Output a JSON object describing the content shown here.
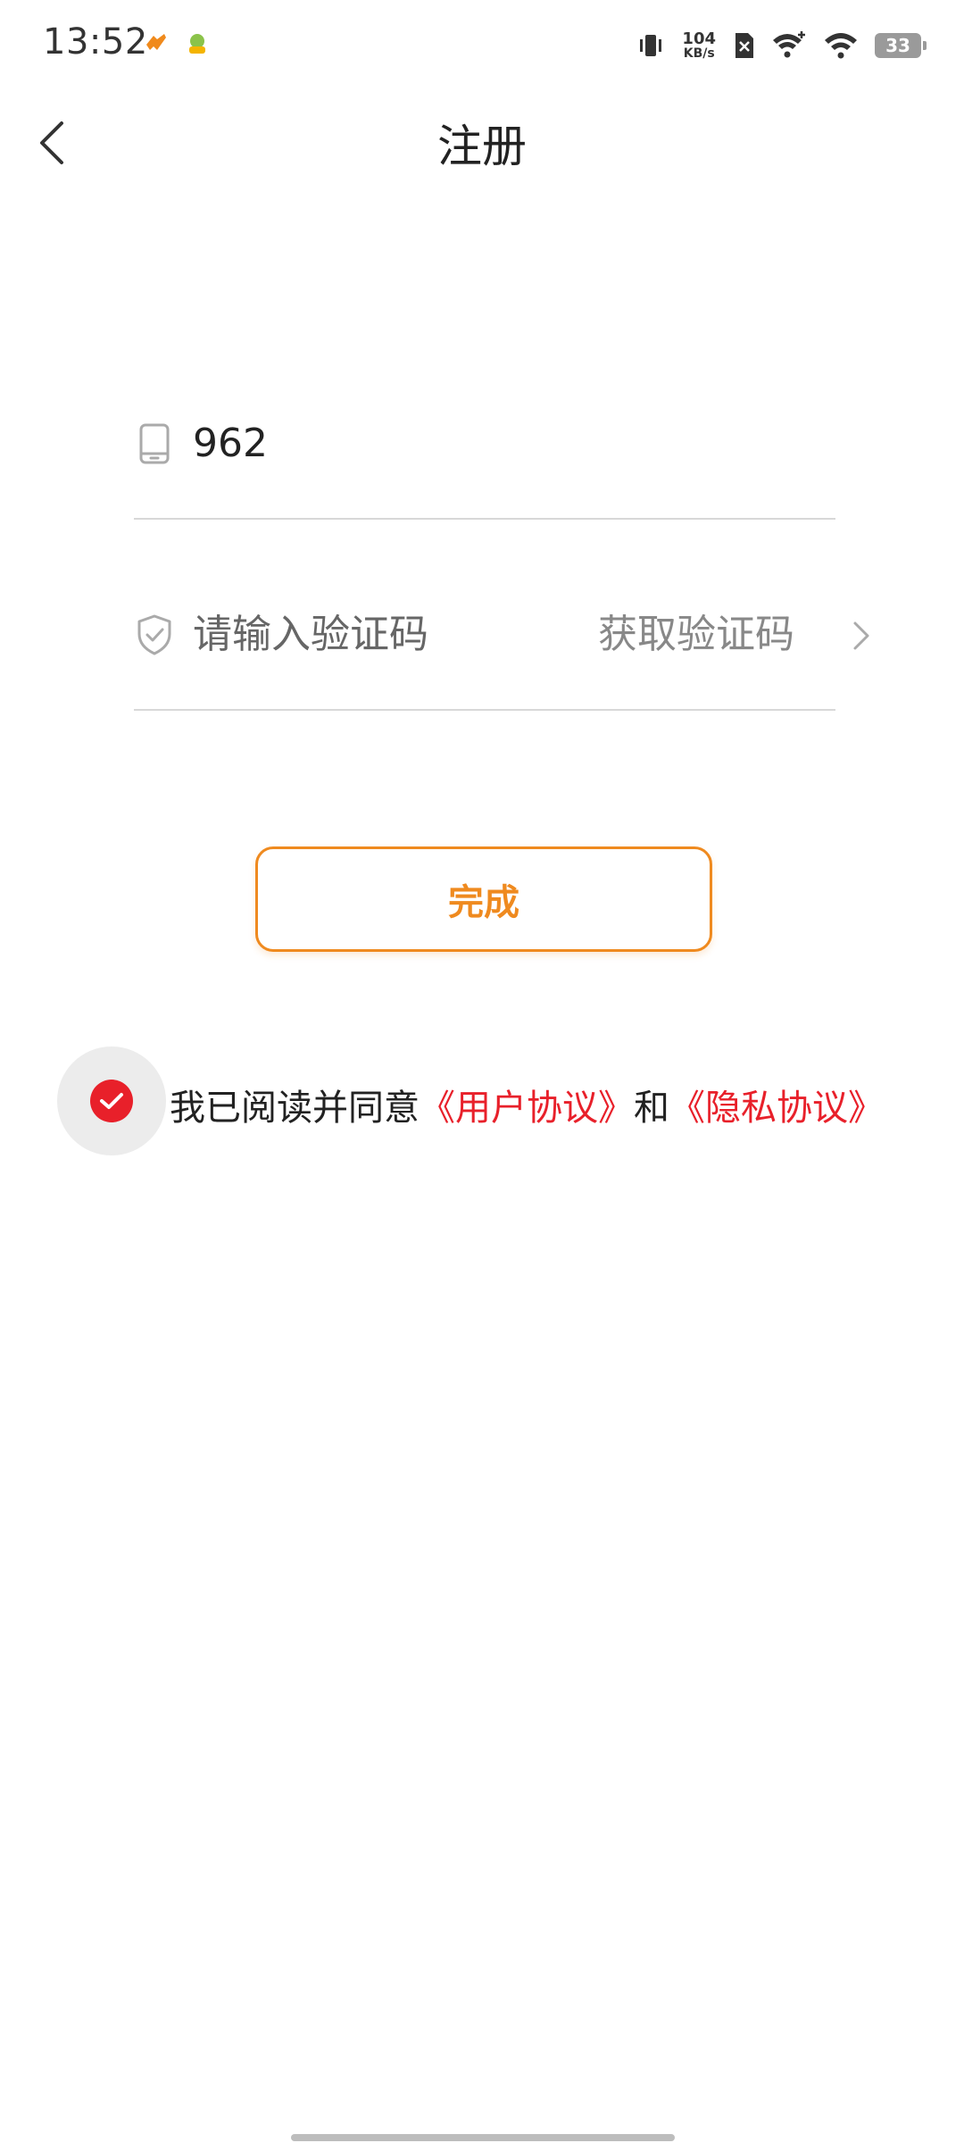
{
  "status_bar": {
    "time": "13:52",
    "net_speed_value": "104",
    "net_speed_unit": "KB/s",
    "battery_level": "33"
  },
  "header": {
    "title": "注册"
  },
  "form": {
    "phone_value": "962",
    "code_placeholder": "请输入验证码",
    "get_code_label": "获取验证码"
  },
  "actions": {
    "done_label": "完成"
  },
  "agreement": {
    "checked": true,
    "prefix": "我已阅读并同意",
    "user_agreement": "《用户协议》",
    "joiner": "和",
    "privacy_agreement": "《隐私协议》"
  },
  "colors": {
    "accent": "#ef8a1f",
    "link_red": "#e8202a",
    "divider": "#d8d8d8"
  }
}
